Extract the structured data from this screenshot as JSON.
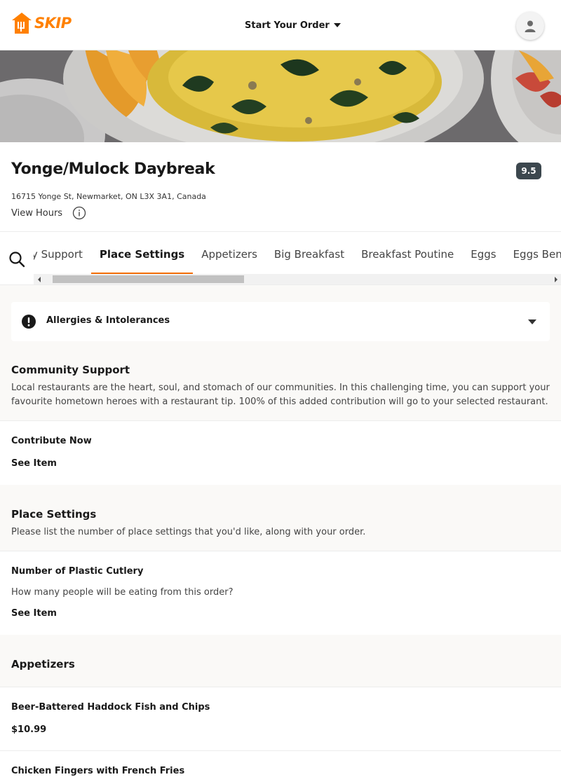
{
  "header": {
    "logo_text": "SKIP",
    "start_order_label": "Start Your Order"
  },
  "restaurant": {
    "name": "Yonge/Mulock Daybreak",
    "rating": "9.5",
    "address": "16715 Yonge St, Newmarket, ON L3X 3A1, Canada",
    "view_hours_label": "View Hours"
  },
  "category_tabs": [
    {
      "label": "Community Support",
      "active": false
    },
    {
      "label": "Place Settings",
      "active": true
    },
    {
      "label": "Appetizers",
      "active": false
    },
    {
      "label": "Big Breakfast",
      "active": false
    },
    {
      "label": "Breakfast Poutine",
      "active": false
    },
    {
      "label": "Eggs",
      "active": false
    },
    {
      "label": "Eggs Benedict",
      "active": false
    }
  ],
  "allergy": {
    "label": "Allergies & Intolerances"
  },
  "sections": {
    "community": {
      "title": "Community Support",
      "description": "Local restaurants are the heart, soul, and stomach of our communities. In this challenging time, you can support your favourite hometown heroes with a restaurant tip. 100% of this added contribution will go to your selected restaurant.",
      "items": [
        {
          "name": "Contribute Now",
          "link": "See Item"
        }
      ]
    },
    "place_settings": {
      "title": "Place Settings",
      "description": "Please list the number of place settings that you'd like, along with your order.",
      "items": [
        {
          "name": "Number of Plastic Cutlery",
          "description": "How many people will be eating from this order?",
          "link": "See Item"
        }
      ]
    },
    "appetizers": {
      "title": "Appetizers",
      "items": [
        {
          "name": "Beer-Battered Haddock Fish and Chips",
          "price": "$10.99"
        },
        {
          "name": "Chicken Fingers with French Fries"
        }
      ]
    }
  },
  "colors": {
    "brand_orange": "#ff8000",
    "tab_underline": "#f36d00",
    "rating_bg": "#3c474e"
  },
  "icons": {
    "search": "search-icon",
    "info": "info-icon",
    "alert": "exclamation-icon",
    "user": "user-icon"
  }
}
